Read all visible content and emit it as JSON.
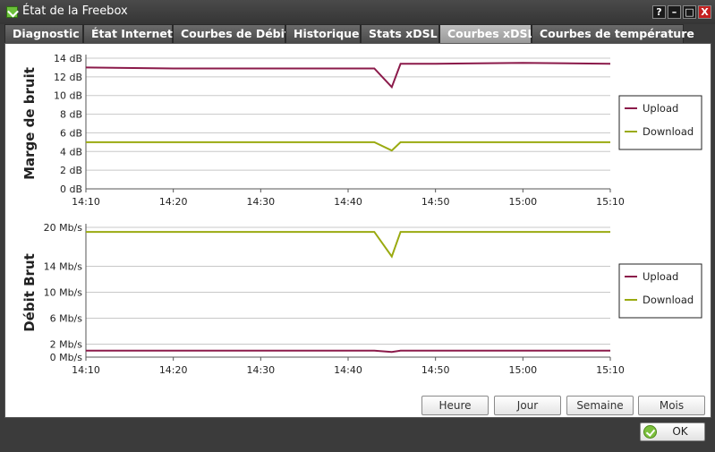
{
  "window": {
    "title": "État de la Freebox",
    "help_label": "?",
    "min_label": "–",
    "max_label": "□",
    "close_label": "X"
  },
  "tabs": [
    {
      "label": "Diagnostic",
      "active": false
    },
    {
      "label": "État Internet",
      "active": false
    },
    {
      "label": "Courbes de Débit",
      "active": false
    },
    {
      "label": "Historique",
      "active": false
    },
    {
      "label": "Stats xDSL",
      "active": false
    },
    {
      "label": "Courbes xDSL",
      "active": true
    },
    {
      "label": "Courbes de température",
      "active": false
    }
  ],
  "charts_common": {
    "x_ticks": [
      "14:10",
      "14:20",
      "14:30",
      "14:40",
      "14:50",
      "15:00",
      "15:10"
    ],
    "upload_color": "#8b1a4a",
    "download_color": "#9aaa10"
  },
  "chart_data": [
    {
      "type": "line",
      "ylabel": "Marge de bruit",
      "ylim": [
        0,
        14
      ],
      "y_ticks": [
        "0 dB",
        "2 dB",
        "4 dB",
        "6 dB",
        "8 dB",
        "10 dB",
        "12 dB",
        "14 dB"
      ],
      "y_tick_values": [
        0,
        2,
        4,
        6,
        8,
        10,
        12,
        14
      ],
      "x": [
        "14:10",
        "14:20",
        "14:30",
        "14:40",
        "14:43",
        "14:45",
        "14:46",
        "14:50",
        "15:00",
        "15:10"
      ],
      "legend": [
        "Upload",
        "Download"
      ],
      "legend_position": "right",
      "grid": true,
      "series": [
        {
          "name": "Upload",
          "values": [
            13.0,
            12.9,
            12.9,
            12.9,
            12.9,
            10.9,
            13.4,
            13.4,
            13.5,
            13.4
          ]
        },
        {
          "name": "Download",
          "values": [
            5.0,
            5.0,
            5.0,
            5.0,
            5.0,
            4.1,
            5.0,
            5.0,
            5.0,
            5.0
          ]
        }
      ]
    },
    {
      "type": "line",
      "ylabel": "Débit Brut",
      "ylim": [
        0,
        20
      ],
      "y_ticks": [
        "0 Mb/s",
        "2 Mb/s",
        "6 Mb/s",
        "10 Mb/s",
        "14 Mb/s",
        "20 Mb/s"
      ],
      "y_tick_values": [
        0,
        2,
        6,
        10,
        14,
        20
      ],
      "x": [
        "14:10",
        "14:20",
        "14:30",
        "14:40",
        "14:43",
        "14:45",
        "14:46",
        "14:50",
        "15:00",
        "15:10"
      ],
      "legend": [
        "Upload",
        "Download"
      ],
      "legend_position": "right",
      "grid": true,
      "series": [
        {
          "name": "Upload",
          "values": [
            1.0,
            1.0,
            1.0,
            1.0,
            1.0,
            0.8,
            1.0,
            1.0,
            1.0,
            1.0
          ]
        },
        {
          "name": "Download",
          "values": [
            19.3,
            19.3,
            19.3,
            19.3,
            19.3,
            15.5,
            19.3,
            19.3,
            19.3,
            19.3
          ]
        }
      ]
    }
  ],
  "period_buttons": [
    "Heure",
    "Jour",
    "Semaine",
    "Mois"
  ],
  "ok_label": "OK"
}
